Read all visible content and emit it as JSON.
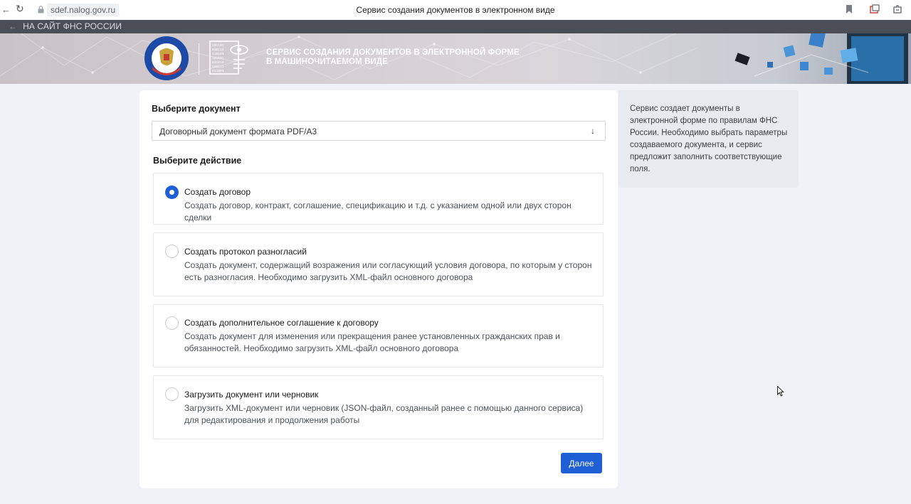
{
  "browser": {
    "back_glyph": "←",
    "reload_glyph": "↻",
    "url": "sdef.nalog.gov.ru",
    "title": "Сервис создания документов в электронном виде"
  },
  "topbar": {
    "back_link": "НА САЙТ ФНС РОССИИ"
  },
  "header": {
    "title_line1": "СЕРВИС СОЗДАНИЯ ДОКУМЕНТОВ В ЭЛЕКТРОННОЙ ФОРМЕ",
    "title_line2": "В МАШИНОЧИТАЕМОМ ВИДЕ",
    "emblem_text": "ФЕДЕРАЛЬНАЯ НАЛОГОВАЯ СЛУЖБА"
  },
  "form": {
    "document_label": "Выберите документ",
    "document_value": "Договорный документ формата PDF/A3",
    "action_label": "Выберите действие",
    "options": [
      {
        "title": "Создать договор",
        "desc": "Создать договор, контракт, соглашение, спецификацию и т.д. с указанием одной или двух сторон сделки",
        "checked": true
      },
      {
        "title": "Создать протокол разногласий",
        "desc": "Создать документ, содержащий возражения или согласующий условия договора, по которым у сторон есть разногласия. Необходимо загрузить XML-файл основного договора",
        "checked": false
      },
      {
        "title": "Создать дополнительное соглашение к договору",
        "desc": "Создать документ для изменения или прекращения ранее установленных гражданских прав и обязанностей. Необходимо загрузить XML-файл основного договора",
        "checked": false
      },
      {
        "title": "Загрузить документ или черновик",
        "desc": "Загрузить XML-документ или черновик (JSON-файл, созданный ранее с помощью данного сервиса) для редактирования и продолжения работы",
        "checked": false
      }
    ],
    "next_label": "Далее"
  },
  "info": {
    "text": "Сервис создает документы в электронной форме по правилам ФНС России. Необходимо выбрать параметры создаваемого документа, и сервис предложит заполнить соответствующие поля."
  },
  "colors": {
    "accent": "#1f5fd6",
    "page_bg": "#f0f2f7",
    "top_strip": "#4a4e56",
    "info_bg": "#e7eaee"
  }
}
